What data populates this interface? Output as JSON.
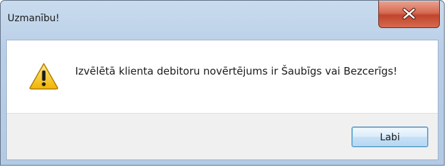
{
  "window": {
    "title": "Uzmanību!",
    "close_icon": "close-icon"
  },
  "dialog": {
    "icon": "warning-icon",
    "message": "Izvēlētā klienta debitoru novērtējums ir Šaubīgs vai Bezcerīgs!",
    "ok_label": "Labi"
  },
  "colors": {
    "close_button": "#c9543d",
    "warning_fill": "#f5c21c",
    "button_border": "#3c7fb1"
  }
}
